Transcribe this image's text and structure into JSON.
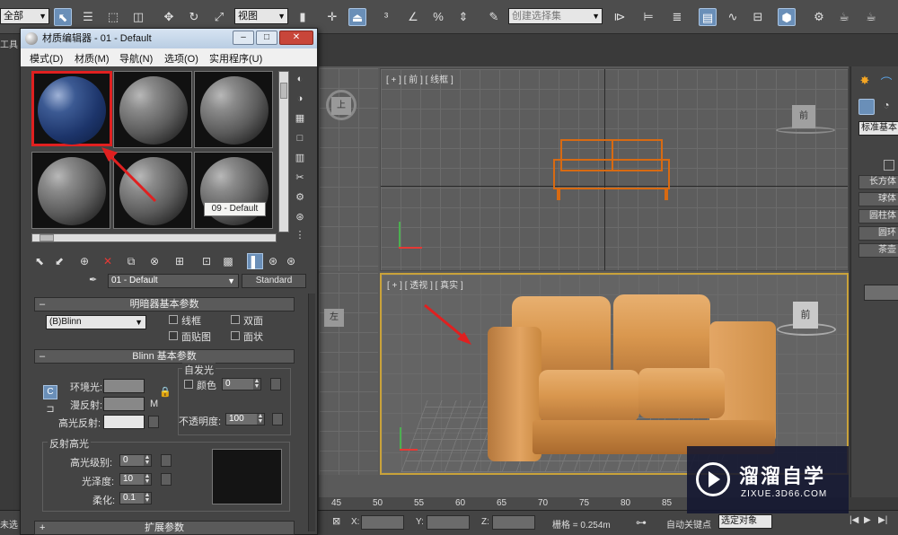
{
  "toolbar": {
    "selection_filter": "全部",
    "reference_coord": "视图",
    "named_selection_placeholder": "创建选择集"
  },
  "material_editor": {
    "title": "材质编辑器 - 01 - Default",
    "menus": [
      "模式(D)",
      "材质(M)",
      "导航(N)",
      "选项(O)",
      "实用程序(U)"
    ],
    "tooltip": "09 - Default",
    "material_name": "01 - Default",
    "material_type": "Standard",
    "shader_rollout": {
      "title": "明暗器基本参数",
      "shader": "(B)Blinn",
      "wire": "线框",
      "two_sided": "双面",
      "face_map": "面贴图",
      "faceted": "面状"
    },
    "blinn_rollout": {
      "title": "Blinn 基本参数",
      "self_illum": "自发光",
      "color": "颜色",
      "self_illum_value": "0",
      "ambient": "环境光:",
      "diffuse": "漫反射:",
      "specular": "高光反射:",
      "m_label": "M",
      "opacity": "不透明度:",
      "opacity_value": "100"
    },
    "specular_highlights": {
      "title": "反射高光",
      "level": "高光级别:",
      "level_value": "0",
      "glossiness": "光泽度:",
      "glossiness_value": "10",
      "soften": "柔化:",
      "soften_value": "0.1"
    },
    "extended_rollout": "扩展参数"
  },
  "viewports": {
    "top_label": "[ + ] [ 前 ] [ 线框 ]",
    "persp_label": "[ + ] [ 透视 ] [ 真实 ]",
    "left_label": "左",
    "top_cube": "上",
    "front_cube": "前",
    "front_cube_top": "前"
  },
  "command_panel": {
    "dropdown": "标准基本",
    "buttons": [
      "长方体",
      "球体",
      "圆柱体",
      "圆环",
      "茶壶"
    ]
  },
  "timeline": {
    "ticks": [
      "45",
      "50",
      "55",
      "60",
      "65",
      "70",
      "75",
      "80",
      "85"
    ]
  },
  "status": {
    "left_text": "未选",
    "x_label": "X:",
    "y_label": "Y:",
    "z_label": "Z:",
    "grid": "栅格 = 0.254m",
    "auto_key": "自动关键点",
    "selected_dropdown": "选定对象"
  },
  "side_labels": {
    "work": "工具"
  },
  "watermark": {
    "brand": "溜溜自学",
    "url": "ZIXUE.3D66.COM"
  }
}
